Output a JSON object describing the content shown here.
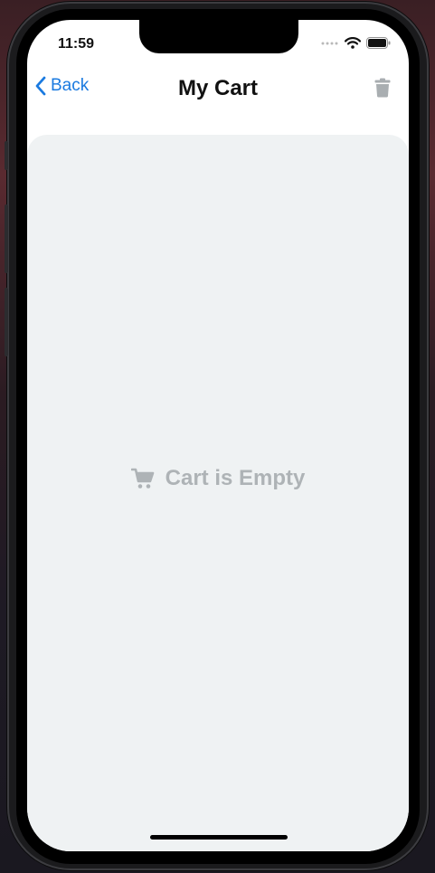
{
  "status_bar": {
    "time": "11:59",
    "icons": [
      "signal-dots-icon",
      "wifi-icon",
      "battery-icon"
    ]
  },
  "navbar": {
    "back_label": "Back",
    "title": "My Cart",
    "back_icon": "chevron-left-icon",
    "trash_icon": "trash-icon"
  },
  "empty_state": {
    "icon": "cart-icon",
    "message": "Cart is Empty"
  },
  "colors": {
    "accent": "#1a7ae0",
    "content_bg": "#eff2f3",
    "muted_text": "#aeb3b6",
    "trash_icon": "#a9aeb1"
  }
}
